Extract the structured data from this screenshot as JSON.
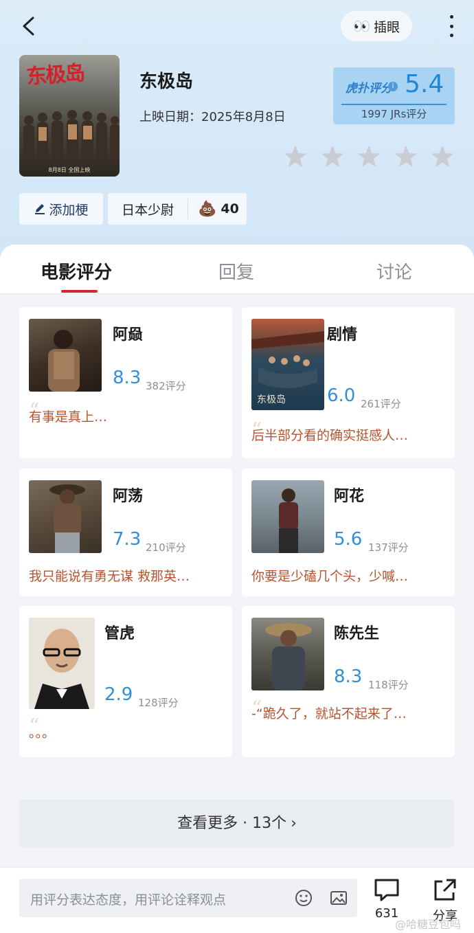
{
  "header": {
    "eyes_label": "插眼",
    "movie_title": "东极岛",
    "release_date": "上映日期：2025年8月8日",
    "poster_title_art": "东极岛",
    "poster_date": "8月8日 全国上映"
  },
  "score": {
    "brand": "虎扑评分",
    "value": "5.4",
    "count": "1997 JRs评分",
    "stars_filled": 0,
    "stars_total": 5
  },
  "tags": {
    "add_label": "添加梗",
    "tag_label": "日本少尉",
    "tag_count": "40"
  },
  "tabs": [
    "电影评分",
    "回复",
    "讨论"
  ],
  "cards": [
    {
      "name": "阿赑",
      "rating": "8.3",
      "count": "382评分",
      "quote": "有事是真上…"
    },
    {
      "name": "剧情",
      "rating": "6.0",
      "count": "261评分",
      "quote": "后半部分看的确实挺感人…"
    },
    {
      "name": "阿荡",
      "rating": "7.3",
      "count": "210评分",
      "quote": "我只能说有勇无谋 救那英…"
    },
    {
      "name": "阿花",
      "rating": "5.6",
      "count": "137评分",
      "quote": "你要是少磕几个头，少喊…"
    },
    {
      "name": "管虎",
      "rating": "2.9",
      "count": "128评分",
      "quote": "。。。"
    },
    {
      "name": "陈先生",
      "rating": "8.3",
      "count": "118评分",
      "quote": "-“跪久了，就站不起来了…"
    }
  ],
  "more": {
    "label": "查看更多 · 13个"
  },
  "bottom": {
    "placeholder": "用评分表达态度，用评论诠释观点",
    "reply_count": "631",
    "share_label": "分享",
    "watermark": "@哈糖豆包吗"
  },
  "colors": {
    "accent": "#2f8fd8",
    "tab_underline": "#d0282e",
    "quote": "#b5542f",
    "header_bg": "#d6e9f8"
  }
}
